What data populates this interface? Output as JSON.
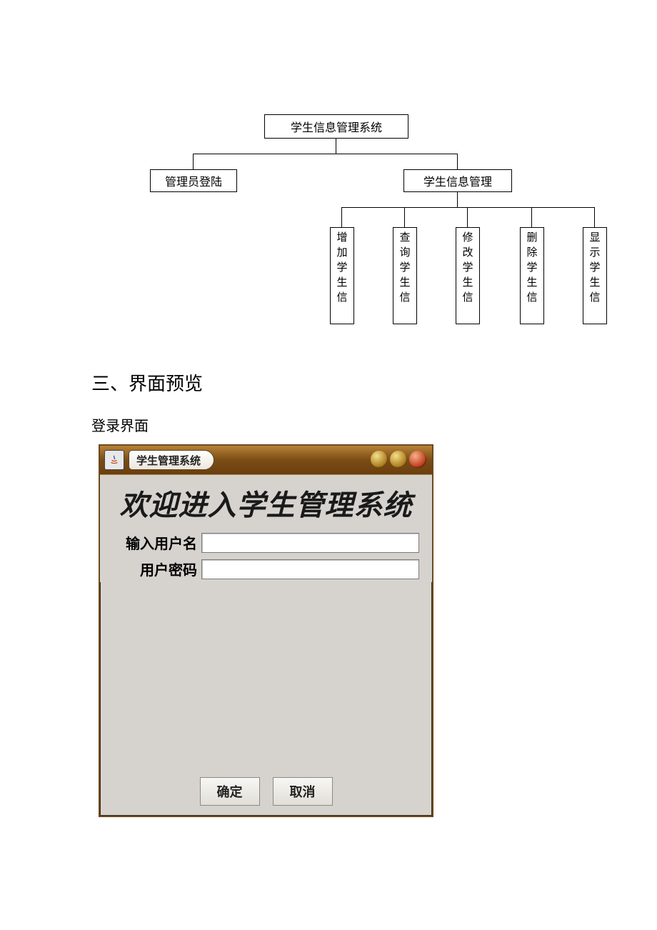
{
  "diagram": {
    "root": "学生信息管理系统",
    "left_child": "管理员登陆",
    "right_child": "学生信息管理",
    "leaves": [
      "增加学生信",
      "查询学生信",
      "修改学生信",
      "删除学生信",
      "显示学生信"
    ]
  },
  "headings": {
    "section": "三、界面预览",
    "subsection": "登录界面"
  },
  "login": {
    "window_title": "学生管理系统",
    "welcome": "欢迎进入学生管理系统",
    "username_label": "输入用户名",
    "password_label": "用户密码",
    "username_value": "",
    "password_value": "",
    "ok_button": "确定",
    "cancel_button": "取消"
  }
}
